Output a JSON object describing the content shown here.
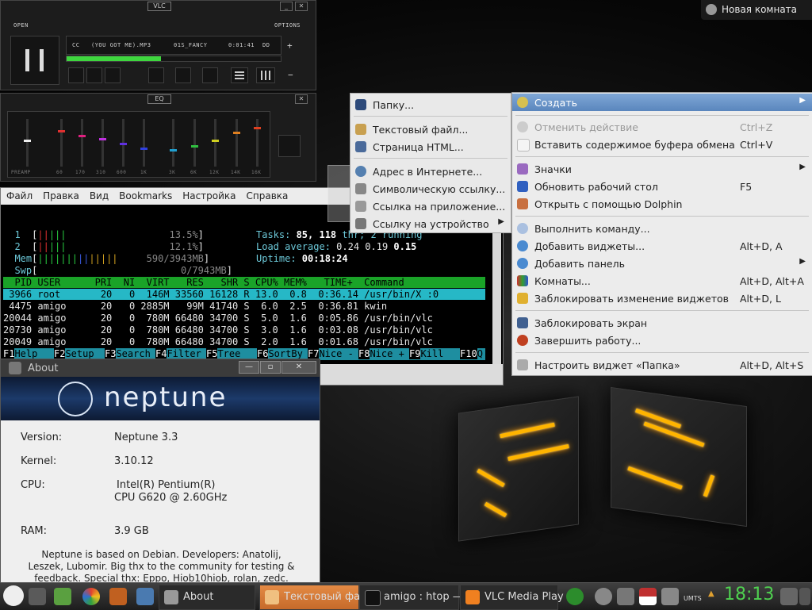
{
  "topright": {
    "label": "Новая комната"
  },
  "vlc": {
    "title": "VLC",
    "open": "OPEN",
    "options": "OPTIONS",
    "track": "(YOU GOT ME).MP3",
    "artist": "01S_FANCY",
    "time": "0:01:41",
    "eq_title": "EQ",
    "preamp": "PREAMP",
    "bands": [
      "60",
      "170",
      "310",
      "600",
      "1K",
      "3K",
      "6K",
      "12K",
      "14K",
      "16K"
    ],
    "progress": 0.44
  },
  "terminal": {
    "menu": [
      "Файл",
      "Правка",
      "Вид",
      "Bookmarks",
      "Настройка",
      "Справка"
    ],
    "cpu1": "13.5%",
    "cpu2": "12.1%",
    "mem": "590/3943MB",
    "swp": "0/7943MB",
    "tasks_label": "Tasks: ",
    "tasks": "85, 118",
    "tasks_rest": " thr; 2 running",
    "load_label": "Load average: ",
    "load": "0.24 0.19 ",
    "load3": "0.15",
    "uptime_label": "Uptime: ",
    "uptime": "00:18:24",
    "header": "  PID USER      PRI  NI  VIRT   RES   SHR S CPU% MEM%   TIME+  Command",
    "rows": [
      " 3966 root       20   0  146M 33560 16128 R 13.0  0.8  0:36.14 /usr/bin/X :0",
      " 4475 amigo      20   0 2885M   99M 41740 S  6.0  2.5  0:36.81 kwin",
      "20044 amigo      20   0  780M 66480 34700 S  5.0  1.6  0:05.86 /usr/bin/vlc",
      "20730 amigo      20   0  780M 66480 34700 S  3.0  1.6  0:03.08 /usr/bin/vlc",
      "20049 amigo      20   0  780M 66480 34700 S  2.0  1.6  0:01.68 /usr/bin/vlc"
    ],
    "fkeys": [
      {
        "k": "F1",
        "l": "Help  "
      },
      {
        "k": "F2",
        "l": "Setup "
      },
      {
        "k": "F3",
        "l": "Search"
      },
      {
        "k": "F4",
        "l": "Filter"
      },
      {
        "k": "F5",
        "l": "Tree  "
      },
      {
        "k": "F6",
        "l": "SortBy"
      },
      {
        "k": "F7",
        "l": "Nice -"
      },
      {
        "k": "F8",
        "l": "Nice +"
      },
      {
        "k": "F9",
        "l": "Kill  "
      },
      {
        "k": "F10",
        "l": "Q"
      }
    ]
  },
  "about": {
    "title": "About",
    "logo": "neptune",
    "version_label": "Version:",
    "version": "Neptune 3.3",
    "kernel_label": "Kernel:",
    "kernel": "3.10.12",
    "cpu_label": "CPU:",
    "cpu_line1": "Intel(R) Pentium(R)",
    "cpu_line2": "CPU G620 @ 2.60GHz",
    "ram_label": "RAM:",
    "ram": "3.9 GB",
    "desc": "Neptune is based on Debian. Developers: Anatolij, Leszek, Lubomir. Big thx to the community for testing & feedback. Special thx: Eppo, Hiob10hiob, rolan, zedc."
  },
  "submenu": {
    "items": [
      "Папку...",
      "Текстовый файл...",
      "Страница HTML...",
      "Адрес в Интернете...",
      "Символическую ссылку...",
      "Ссылка на приложение...",
      "Ссылку на устройство"
    ]
  },
  "menu": {
    "create": "Создать",
    "undo": "Отменить действие",
    "undo_sc": "Ctrl+Z",
    "paste": "Вставить содержимое буфера обмена",
    "paste_sc": "Ctrl+V",
    "icons": "Значки",
    "refresh": "Обновить рабочий стол",
    "refresh_sc": "F5",
    "dolphin": "Открыть с помощью Dolphin",
    "run": "Выполнить команду...",
    "widgets": "Добавить виджеты...",
    "widgets_sc": "Alt+D, A",
    "panel": "Добавить панель",
    "rooms": "Комнаты...",
    "rooms_sc": "Alt+D, Alt+A",
    "lockw": "Заблокировать изменение виджетов",
    "lockw_sc": "Alt+D, L",
    "lockscr": "Заблокировать экран",
    "logout": "Завершить работу...",
    "config": "Настроить виджет «Папка»",
    "config_sc": "Alt+D, Alt+S"
  },
  "taskbar": {
    "tasks": [
      "About",
      "Текстовый фа",
      "amigo : htop —",
      "VLC Media Play"
    ],
    "net": "UMTS",
    "clock": "18:13"
  },
  "colors": {
    "highlight": "#5a86bd",
    "clock": "#4fd150",
    "htop_header": "#1aa328",
    "htop_sel": "#26b8c6"
  }
}
